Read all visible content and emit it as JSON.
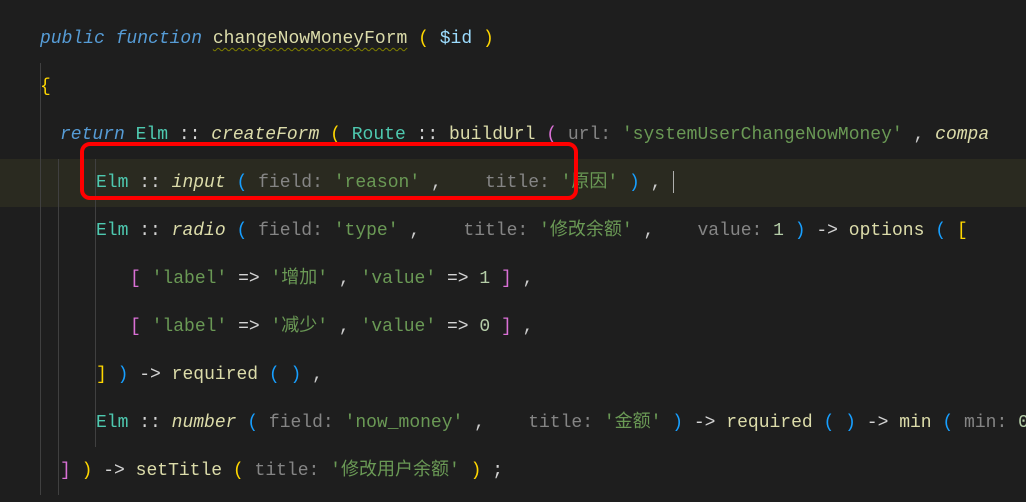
{
  "code": {
    "kw_public": "public",
    "kw_function": "function",
    "fn_name": "changeNowMoneyForm",
    "param": "$id",
    "kw_return": "return",
    "cls_elm": "Elm",
    "sep": "::",
    "fn_createForm": "createForm",
    "cls_route": "Route",
    "fn_buildUrl": "buildUrl",
    "hint_url": " url: ",
    "str_sysUser": "'systemUserChangeNowMoney'",
    "fn_compact_word": "compa",
    "fn_input": "input",
    "hint_field": " field: ",
    "str_reason": "'reason'",
    "hint_title": " title: ",
    "str_reason_title": "'原因'",
    "fn_radio": "radio",
    "str_type": "'type'",
    "str_modify_balance": "'修改余额'",
    "hint_value": " value: ",
    "num_1": "1",
    "fn_options": "options",
    "str_label": "'label'",
    "arrow": " => ",
    "str_increase": "'增加'",
    "str_value": "'value'",
    "str_decrease": "'减少'",
    "num_0": "0",
    "fn_required": "required",
    "fn_number": "number",
    "str_now_money": "'now_money'",
    "str_amount": "'金额'",
    "fn_min": "min",
    "hint_min": " min: ",
    "fn_setTitle": "setTitle",
    "str_modify_user_balance": "'修改用户余额'",
    "obrace": "{",
    "cbrace": "}",
    "oparen": "(",
    "cparen": ")",
    "obracket": "[",
    "cbracket": "]",
    "comma": ",",
    "semi": ";",
    "arrow_op": "->"
  }
}
